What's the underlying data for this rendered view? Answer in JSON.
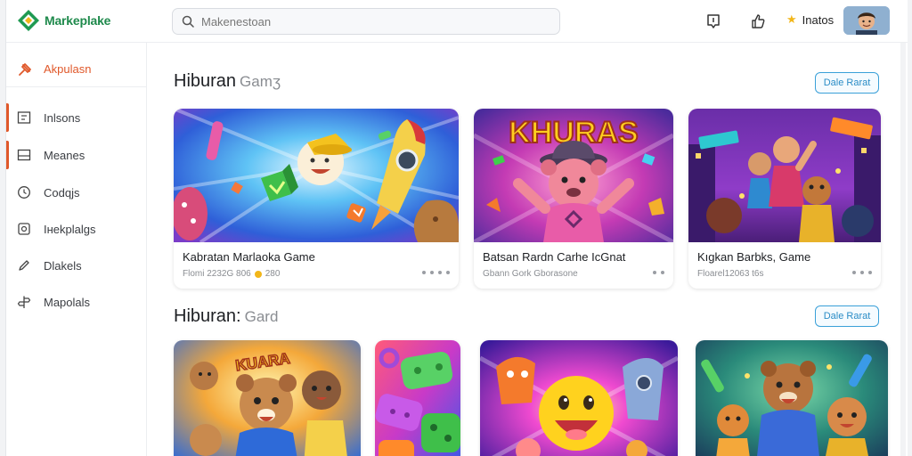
{
  "header": {
    "logo_text": "Markeplake",
    "search_placeholder": "Makenestoan",
    "user_label": "Inatos"
  },
  "sidebar": {
    "top_item": {
      "label": "Akpulasn",
      "icon": "pin-icon"
    },
    "items": [
      {
        "label": "Inlsons",
        "icon": "grid-icon"
      },
      {
        "label": "Meanes",
        "icon": "tray-icon"
      },
      {
        "label": "Codqjs",
        "icon": "clock-icon"
      },
      {
        "label": "Iнekplalgs",
        "icon": "square-icon"
      },
      {
        "label": "Dlakels",
        "icon": "pencil-icon"
      },
      {
        "label": "Mapolals",
        "icon": "signpost-icon"
      }
    ]
  },
  "sections": [
    {
      "title": "Hiburan",
      "subtitle": "Gamʒ",
      "see_all": "Dale Rarat",
      "cards": [
        {
          "title": "Kabratan Marlaoka Game",
          "meta": "Flomi 2232G 806",
          "price": "280",
          "dots": 4
        },
        {
          "title": "Batsan Rardn Carhe IcGnat",
          "meta": "Gbann Gork Gborasone",
          "price": "",
          "dots": 2
        },
        {
          "title": "Kıgkan Barbks, Game",
          "meta": "Floarel12063 t6s",
          "price": "",
          "dots": 3
        }
      ]
    },
    {
      "title": "Hiburan:",
      "subtitle": "Gard",
      "see_all": "Dale Rarat"
    }
  ],
  "banners": [
    {
      "text": "KHURAS"
    },
    {
      "text": "KUARA"
    }
  ],
  "colors": {
    "accent": "#e0582a",
    "brand": "#1f8a4c",
    "link": "#2a8cc6"
  }
}
